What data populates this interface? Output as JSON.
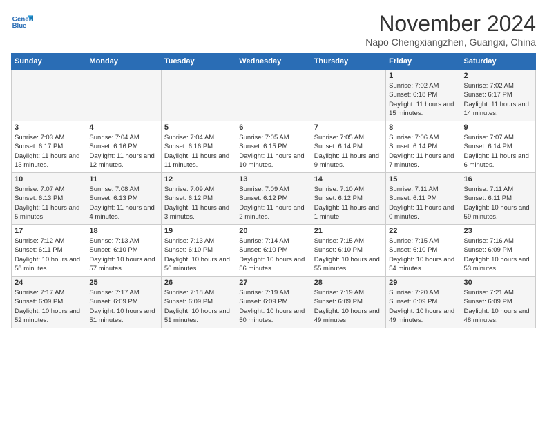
{
  "logo": {
    "line1": "General",
    "line2": "Blue"
  },
  "title": "November 2024",
  "location": "Napo Chengxiangzhen, Guangxi, China",
  "weekdays": [
    "Sunday",
    "Monday",
    "Tuesday",
    "Wednesday",
    "Thursday",
    "Friday",
    "Saturday"
  ],
  "weeks": [
    [
      {
        "day": "",
        "info": ""
      },
      {
        "day": "",
        "info": ""
      },
      {
        "day": "",
        "info": ""
      },
      {
        "day": "",
        "info": ""
      },
      {
        "day": "",
        "info": ""
      },
      {
        "day": "1",
        "info": "Sunrise: 7:02 AM\nSunset: 6:18 PM\nDaylight: 11 hours and 15 minutes."
      },
      {
        "day": "2",
        "info": "Sunrise: 7:02 AM\nSunset: 6:17 PM\nDaylight: 11 hours and 14 minutes."
      }
    ],
    [
      {
        "day": "3",
        "info": "Sunrise: 7:03 AM\nSunset: 6:17 PM\nDaylight: 11 hours and 13 minutes."
      },
      {
        "day": "4",
        "info": "Sunrise: 7:04 AM\nSunset: 6:16 PM\nDaylight: 11 hours and 12 minutes."
      },
      {
        "day": "5",
        "info": "Sunrise: 7:04 AM\nSunset: 6:16 PM\nDaylight: 11 hours and 11 minutes."
      },
      {
        "day": "6",
        "info": "Sunrise: 7:05 AM\nSunset: 6:15 PM\nDaylight: 11 hours and 10 minutes."
      },
      {
        "day": "7",
        "info": "Sunrise: 7:05 AM\nSunset: 6:14 PM\nDaylight: 11 hours and 9 minutes."
      },
      {
        "day": "8",
        "info": "Sunrise: 7:06 AM\nSunset: 6:14 PM\nDaylight: 11 hours and 7 minutes."
      },
      {
        "day": "9",
        "info": "Sunrise: 7:07 AM\nSunset: 6:14 PM\nDaylight: 11 hours and 6 minutes."
      }
    ],
    [
      {
        "day": "10",
        "info": "Sunrise: 7:07 AM\nSunset: 6:13 PM\nDaylight: 11 hours and 5 minutes."
      },
      {
        "day": "11",
        "info": "Sunrise: 7:08 AM\nSunset: 6:13 PM\nDaylight: 11 hours and 4 minutes."
      },
      {
        "day": "12",
        "info": "Sunrise: 7:09 AM\nSunset: 6:12 PM\nDaylight: 11 hours and 3 minutes."
      },
      {
        "day": "13",
        "info": "Sunrise: 7:09 AM\nSunset: 6:12 PM\nDaylight: 11 hours and 2 minutes."
      },
      {
        "day": "14",
        "info": "Sunrise: 7:10 AM\nSunset: 6:12 PM\nDaylight: 11 hours and 1 minute."
      },
      {
        "day": "15",
        "info": "Sunrise: 7:11 AM\nSunset: 6:11 PM\nDaylight: 11 hours and 0 minutes."
      },
      {
        "day": "16",
        "info": "Sunrise: 7:11 AM\nSunset: 6:11 PM\nDaylight: 10 hours and 59 minutes."
      }
    ],
    [
      {
        "day": "17",
        "info": "Sunrise: 7:12 AM\nSunset: 6:11 PM\nDaylight: 10 hours and 58 minutes."
      },
      {
        "day": "18",
        "info": "Sunrise: 7:13 AM\nSunset: 6:10 PM\nDaylight: 10 hours and 57 minutes."
      },
      {
        "day": "19",
        "info": "Sunrise: 7:13 AM\nSunset: 6:10 PM\nDaylight: 10 hours and 56 minutes."
      },
      {
        "day": "20",
        "info": "Sunrise: 7:14 AM\nSunset: 6:10 PM\nDaylight: 10 hours and 56 minutes."
      },
      {
        "day": "21",
        "info": "Sunrise: 7:15 AM\nSunset: 6:10 PM\nDaylight: 10 hours and 55 minutes."
      },
      {
        "day": "22",
        "info": "Sunrise: 7:15 AM\nSunset: 6:10 PM\nDaylight: 10 hours and 54 minutes."
      },
      {
        "day": "23",
        "info": "Sunrise: 7:16 AM\nSunset: 6:09 PM\nDaylight: 10 hours and 53 minutes."
      }
    ],
    [
      {
        "day": "24",
        "info": "Sunrise: 7:17 AM\nSunset: 6:09 PM\nDaylight: 10 hours and 52 minutes."
      },
      {
        "day": "25",
        "info": "Sunrise: 7:17 AM\nSunset: 6:09 PM\nDaylight: 10 hours and 51 minutes."
      },
      {
        "day": "26",
        "info": "Sunrise: 7:18 AM\nSunset: 6:09 PM\nDaylight: 10 hours and 51 minutes."
      },
      {
        "day": "27",
        "info": "Sunrise: 7:19 AM\nSunset: 6:09 PM\nDaylight: 10 hours and 50 minutes."
      },
      {
        "day": "28",
        "info": "Sunrise: 7:19 AM\nSunset: 6:09 PM\nDaylight: 10 hours and 49 minutes."
      },
      {
        "day": "29",
        "info": "Sunrise: 7:20 AM\nSunset: 6:09 PM\nDaylight: 10 hours and 49 minutes."
      },
      {
        "day": "30",
        "info": "Sunrise: 7:21 AM\nSunset: 6:09 PM\nDaylight: 10 hours and 48 minutes."
      }
    ]
  ]
}
